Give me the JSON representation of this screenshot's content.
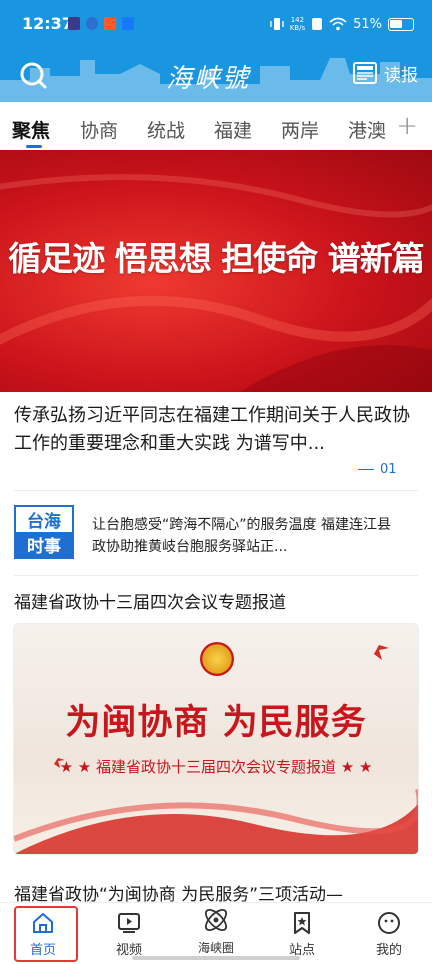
{
  "status_bar": {
    "time": "12:37",
    "speed_value": "142",
    "speed_unit": "KB/s",
    "battery": "51%"
  },
  "header": {
    "logo_text": "海峡號",
    "read_label": "读报"
  },
  "tabs": [
    {
      "label": "聚焦",
      "active": true
    },
    {
      "label": "协商",
      "active": false
    },
    {
      "label": "统战",
      "active": false
    },
    {
      "label": "福建",
      "active": false
    },
    {
      "label": "两岸",
      "active": false
    },
    {
      "label": "港澳",
      "active": false
    }
  ],
  "banner": {
    "image_text": "循足迹 悟思想 担使命 谱新篇",
    "headline": "传承弘扬习近平同志在福建工作期间关于人民政协工作的重要理念和重大实践 为谱写中...",
    "page_indicator": "01"
  },
  "taihai_news": {
    "thumb_top": "台海",
    "thumb_bottom": "时事",
    "text": "让台胞感受“跨海不隔心”的服务温度 福建连江县政协助推黄岐台胞服务驿站正..."
  },
  "section": {
    "title": "福建省政协十三届四次会议专题报道",
    "card_main_text": "为闽协商 为民服务",
    "card_sub_text": "★ ★ 福建省政协十三届四次会议专题报道 ★ ★"
  },
  "next_article": {
    "title": "福建省政协“为闽协商 为民服务”三项活动—"
  },
  "bottom_nav": [
    {
      "label": "首页",
      "icon": "home-icon",
      "active": true
    },
    {
      "label": "视频",
      "icon": "video-icon",
      "active": false
    },
    {
      "label": "海峡圈",
      "icon": "circle-atom-icon",
      "active": false
    },
    {
      "label": "站点",
      "icon": "bookmark-star-icon",
      "active": false
    },
    {
      "label": "我的",
      "icon": "smile-face-icon",
      "active": false
    }
  ],
  "colors": {
    "header_blue": "#1a96e0",
    "accent_blue": "#1a6fd8",
    "banner_red": "#c9121a",
    "highlight_red": "#e53935"
  }
}
